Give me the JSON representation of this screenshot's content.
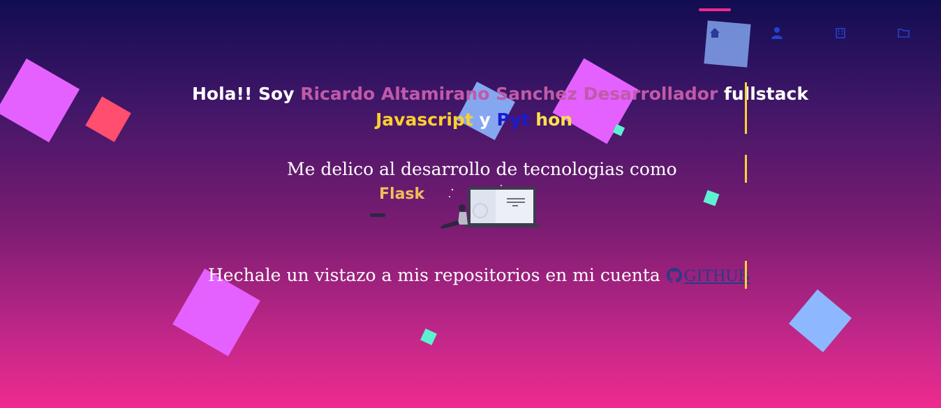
{
  "colors": {
    "accent": "#f02a8e",
    "name_color": "#c05aa8",
    "javascript_color": "#ffcf2e",
    "python_blue": "#1a1ad0",
    "python_yellow": "#ffe24a",
    "cursor_color": "#ffd23a",
    "link_color": "#2c3a86"
  },
  "nav": {
    "items": [
      {
        "name": "home",
        "icon": "home-icon"
      },
      {
        "name": "about",
        "icon": "user-icon"
      },
      {
        "name": "work",
        "icon": "building-icon"
      },
      {
        "name": "projects",
        "icon": "folder-icon"
      }
    ]
  },
  "hero": {
    "greeting": "Hola!! Soy ",
    "name_title": "Ricardo Altamirano Sanchez Desarrollador",
    "fullstack": " fullstack",
    "javascript": "Javascript",
    "and": " y ",
    "python_part1": "Pyt",
    "python_part2": " hon",
    "dedication": "Me delico al desarrollo de tecnologias como",
    "flask_text": "Flask",
    "repo_text": "Hechale un vistazo a mis repositorios en mi cuenta ",
    "github_label": "GITHUB"
  }
}
